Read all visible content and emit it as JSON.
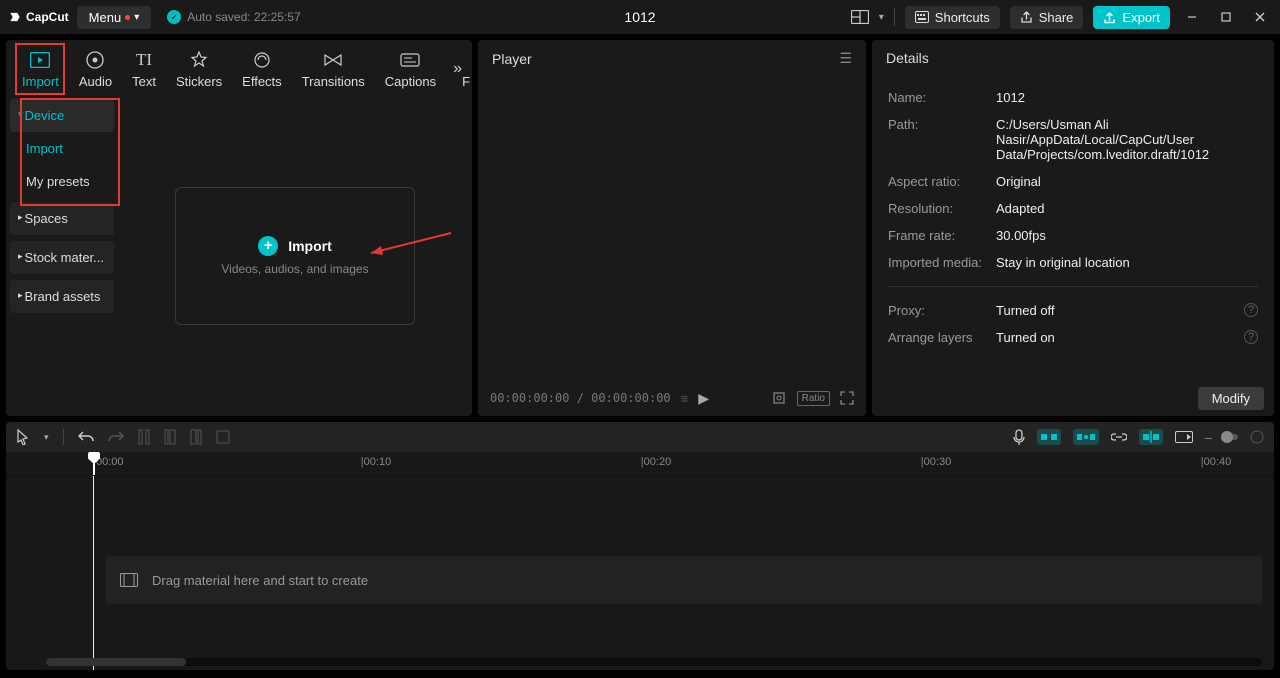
{
  "titlebar": {
    "app_name": "CapCut",
    "menu_label": "Menu",
    "autosave_label": "Auto saved: 22:25:57",
    "project_title": "1012",
    "shortcuts_label": "Shortcuts",
    "share_label": "Share",
    "export_label": "Export"
  },
  "tabs": {
    "import": "Import",
    "audio": "Audio",
    "text": "Text",
    "stickers": "Stickers",
    "effects": "Effects",
    "transitions": "Transitions",
    "captions": "Captions",
    "filters": "F"
  },
  "sidebar": {
    "device": "Device",
    "import": "Import",
    "presets": "My presets",
    "spaces": "Spaces",
    "stock": "Stock mater...",
    "brand": "Brand assets"
  },
  "import_box": {
    "title": "Import",
    "subtitle": "Videos, audios, and images"
  },
  "player": {
    "header": "Player",
    "time_current": "00:00:00:00",
    "time_total": "00:00:00:00",
    "ratio_label": "Ratio"
  },
  "details": {
    "header": "Details",
    "name_label": "Name:",
    "name_value": "1012",
    "path_label": "Path:",
    "path_value": "C:/Users/Usman Ali Nasir/AppData/Local/CapCut/User Data/Projects/com.lveditor.draft/1012",
    "aspect_label": "Aspect ratio:",
    "aspect_value": "Original",
    "resolution_label": "Resolution:",
    "resolution_value": "Adapted",
    "framerate_label": "Frame rate:",
    "framerate_value": "30.00fps",
    "imported_label": "Imported media:",
    "imported_value": "Stay in original location",
    "proxy_label": "Proxy:",
    "proxy_value": "Turned off",
    "layers_label": "Arrange layers",
    "layers_value": "Turned on",
    "modify_label": "Modify"
  },
  "timeline": {
    "ticks": [
      "00:00",
      "|00:10",
      "|00:20",
      "|00:30",
      "|00:40"
    ],
    "drop_hint": "Drag material here and start to create"
  }
}
